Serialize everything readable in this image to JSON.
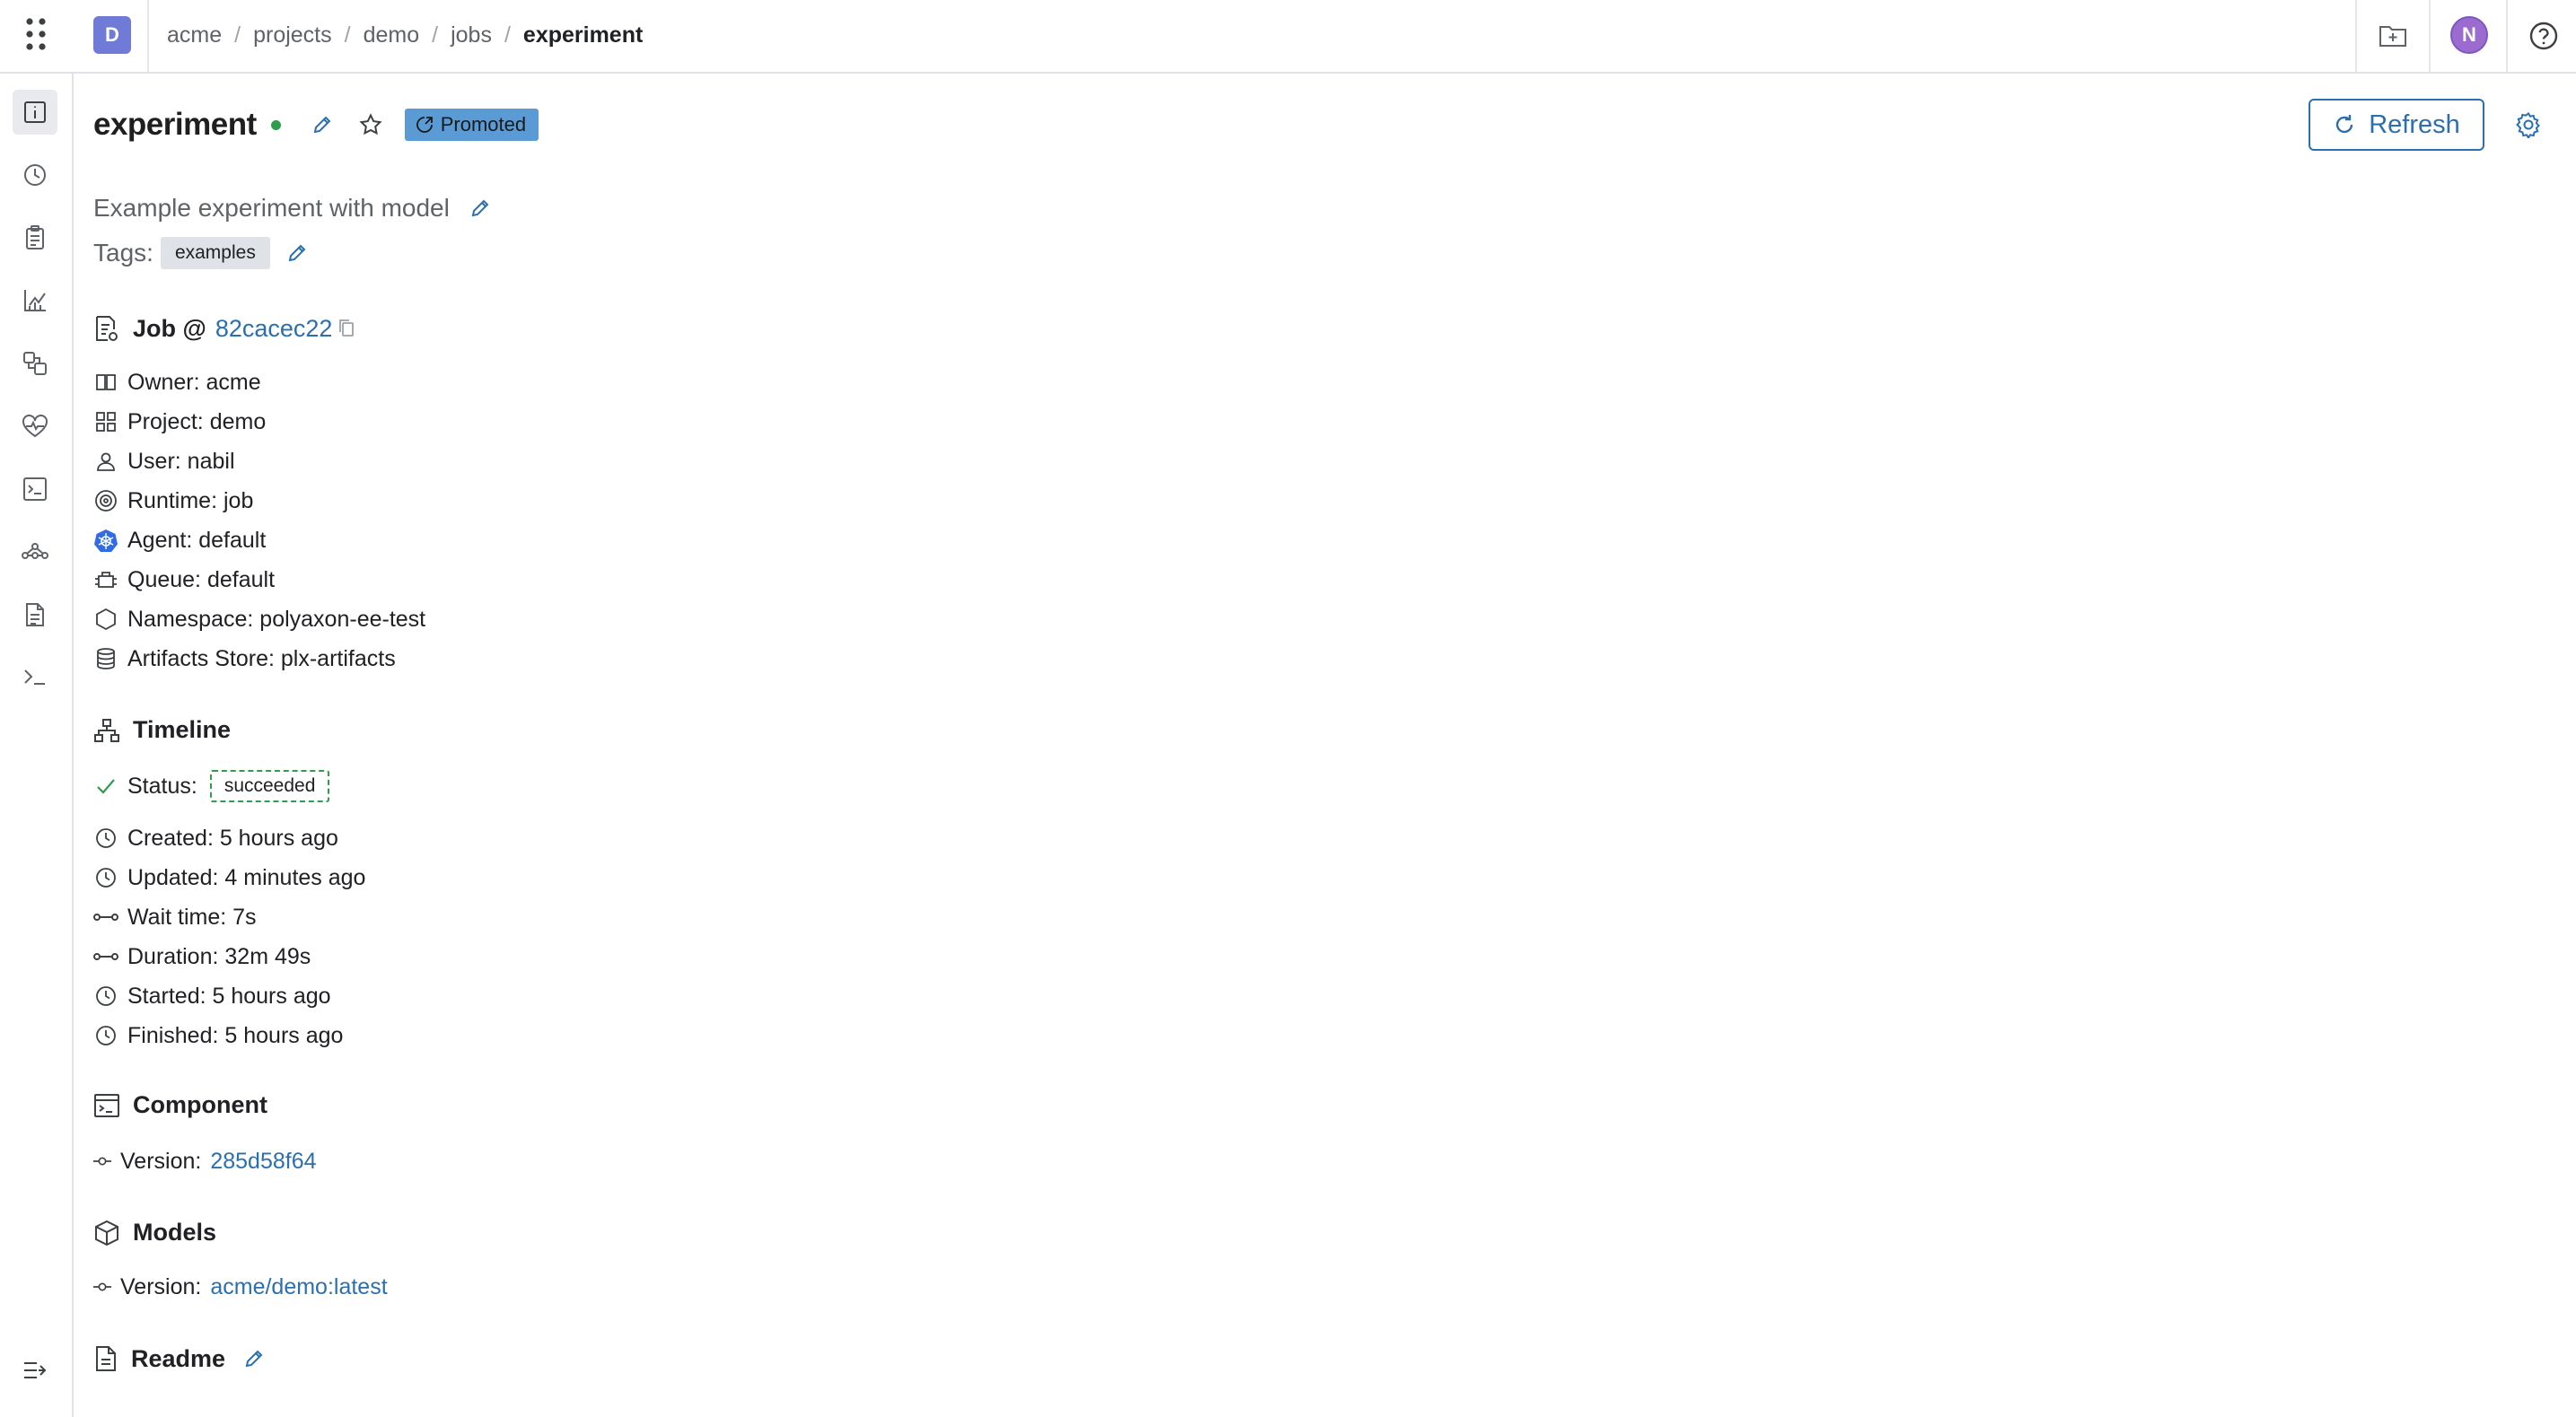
{
  "topbar": {
    "workspace_initial": "D",
    "breadcrumbs": [
      "acme",
      "projects",
      "demo",
      "jobs",
      "experiment"
    ],
    "user_initial": "N"
  },
  "header": {
    "title": "experiment",
    "status_color": "#2e9d4e",
    "promoted_label": "Promoted",
    "refresh_label": "Refresh"
  },
  "description": "Example experiment with model",
  "tags": {
    "label": "Tags:",
    "items": [
      "examples"
    ]
  },
  "job": {
    "title": "Job @",
    "hash": "82cacec22",
    "owner": "Owner: acme",
    "project": "Project: demo",
    "user": "User: nabil",
    "runtime": "Runtime: job",
    "agent": "Agent: default",
    "queue": "Queue: default",
    "namespace": "Namespace: polyaxon-ee-test",
    "artifacts_store": "Artifacts Store: plx-artifacts"
  },
  "timeline": {
    "title": "Timeline",
    "status_label": "Status:",
    "status_value": "succeeded",
    "created": "Created: 5 hours ago",
    "updated": "Updated: 4 minutes ago",
    "wait_time": "Wait time: 7s",
    "duration": "Duration: 32m 49s",
    "started": "Started: 5 hours ago",
    "finished": "Finished: 5 hours ago"
  },
  "component": {
    "title": "Component",
    "version_label": "Version:",
    "version_value": "285d58f64"
  },
  "models": {
    "title": "Models",
    "version_label": "Version:",
    "version_value": "acme/demo:latest"
  },
  "readme": {
    "title": "Readme"
  },
  "colors": {
    "accent": "#2a6fb0",
    "success": "#2e9d4e",
    "promoted_bg": "#5b9bd5",
    "workspace_bg": "#6f7bd6",
    "user_bg": "#9b6bd0"
  }
}
